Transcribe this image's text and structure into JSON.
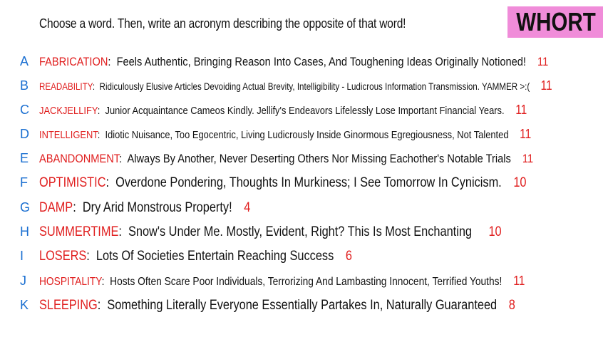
{
  "header": {
    "prompt": "Choose a word. Then, write an acronym describing the opposite of that word!",
    "badge": "WHORT"
  },
  "items": [
    {
      "letter": "A",
      "word": "FABRICATION",
      "acronym": "Feels Authentic, Bringing Reason Into Cases, And Toughening Ideas Originally Notioned!",
      "count": "11"
    },
    {
      "letter": "B",
      "word": "READABILITY",
      "acronym": "Ridiculously Elusive Articles Devoiding Actual Brevity, Intelligibility - Ludicrous Information Transmission. YAMMER >:(",
      "count": "11"
    },
    {
      "letter": "C",
      "word": "JACKJELLIFY",
      "acronym": "Junior Acquaintance Cameos Kindly. Jellify's Endeavors Lifelessly Lose Important Financial Years.",
      "count": "11"
    },
    {
      "letter": "D",
      "word": "INTELLIGENT",
      "acronym": "Idiotic Nuisance, Too Egocentric, Living Ludicrously Inside Ginormous Egregiousness, Not Talented",
      "count": "11"
    },
    {
      "letter": "E",
      "word": "ABANDONMENT",
      "acronym": "Always By Another, Never Deserting Others Nor Missing Eachother's Notable Trials",
      "count": "11"
    },
    {
      "letter": "F",
      "word": "OPTIMISTIC",
      "acronym": "Overdone Pondering, Thoughts In Murkiness; I See Tomorrow In Cynicism.",
      "count": "10"
    },
    {
      "letter": "G",
      "word": "DAMP",
      "acronym": "Dry Arid Monstrous Property!",
      "count": "4"
    },
    {
      "letter": "H",
      "word": "SUMMERTIME",
      "acronym": "Snow's Under Me. Mostly, Evident, Right? This Is Most Enchanting",
      "count": "10"
    },
    {
      "letter": "I",
      "word": "LOSERS",
      "acronym": "Lots Of Societies Entertain Reaching Success",
      "count": "6"
    },
    {
      "letter": "J",
      "word": "HOSPITALITY",
      "acronym": "Hosts Often Scare Poor Individuals, Terrorizing And Lambasting Innocent, Terrified Youths!",
      "count": "11"
    },
    {
      "letter": "K",
      "word": "SLEEPING",
      "acronym": "Something Literally Everyone Essentially Partakes In, Naturally Guaranteed",
      "count": "8"
    }
  ]
}
